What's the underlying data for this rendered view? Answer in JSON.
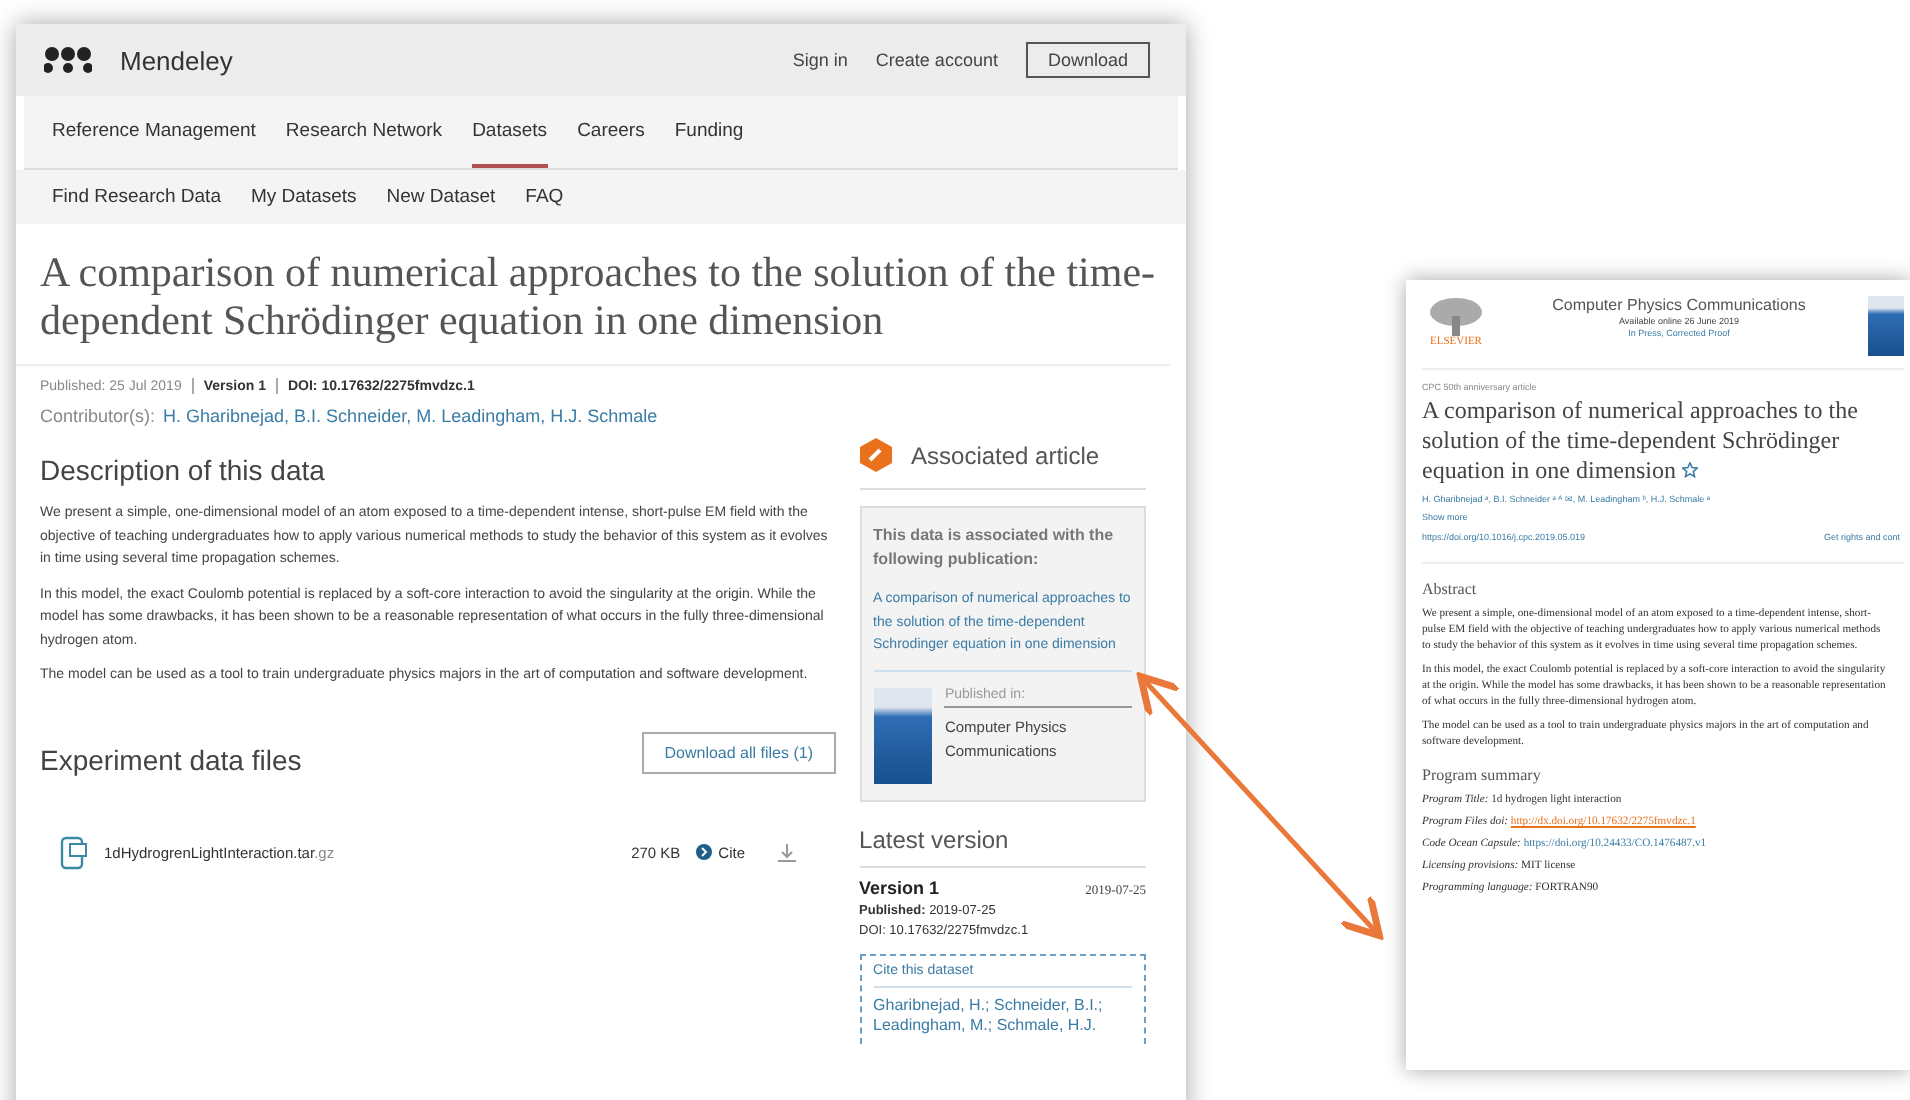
{
  "dataset_page": {
    "header": {
      "brand": "Mendeley",
      "links": [
        "Sign in",
        "Create account"
      ],
      "download_button": "Download"
    },
    "nav": [
      {
        "label": "Reference Management",
        "selected": false
      },
      {
        "label": "Research Network",
        "selected": false
      },
      {
        "label": "Datasets",
        "selected": true
      },
      {
        "label": "Careers",
        "selected": false
      },
      {
        "label": "Funding",
        "selected": false
      }
    ],
    "subnav": [
      "Find Research Data",
      "My Datasets",
      "New Dataset",
      "FAQ"
    ],
    "title": "A comparison of numerical approaches to the solution of the time-dependent Schrödinger equation in one dimension",
    "meta": {
      "published": "Published: 25 Jul 2019",
      "version": "Version 1",
      "doi": "DOI: 10.17632/2275fmvdzc.1"
    },
    "contributors_label": "Contributor(s):",
    "contributors": "H. Gharibnejad, B.I. Schneider, M. Leadingham, H.J. Schmale",
    "description_heading": "Description of this data",
    "description": [
      "We present a simple, one-dimensional model of an atom exposed to a time-dependent intense, short-pulse EM field with the objective of teaching undergraduates how to apply various numerical methods to study the behavior of this system as it evolves in time using several time propagation schemes.",
      "In this model, the exact Coulomb potential is replaced by a soft-core interaction to avoid the singularity at the origin. While the model has some drawbacks, it has been shown to be a reasonable representation of what occurs in the fully three-dimensional hydrogen atom.",
      "The model can be used as a tool to train undergraduate physics majors in the art of computation and software development."
    ],
    "files_heading": "Experiment data files",
    "download_all": "Download all files (1)",
    "files": [
      {
        "name": "1dHydrogrenLightInteraction.tar",
        "ext": ".gz",
        "size": "270 KB",
        "cite": "Cite"
      }
    ],
    "associated": {
      "heading": "Associated article",
      "intro": "This data is associated with the following publication:",
      "link": "A comparison of numerical approaches to the solution of the time-dependent Schrodinger equation in one dimension",
      "published_in_label": "Published in:",
      "journal": "Computer Physics Communications"
    },
    "latest": {
      "heading": "Latest version",
      "version": "Version 1",
      "date": "2019-07-25",
      "published_label": "Published:",
      "published": "2019-07-25",
      "doi": "DOI: 10.17632/2275fmvdzc.1",
      "cite_label": "Cite this dataset",
      "citation": "Gharibnejad, H.; Schneider, B.I.; Leadingham, M.; Schmale, H.J."
    }
  },
  "article_page": {
    "journal": "Computer Physics Communications",
    "publisher": "ELSEVIER",
    "available": "Available online 26 June 2019",
    "status": "In Press, Corrected Proof",
    "article_type": "CPC 50th anniversary article",
    "title": "A comparison of numerical approaches to the solution of the time-dependent Schrödinger equation in one dimension",
    "authors": "H. Gharibnejad ᵃ, B.I. Schneider ᵃ ᴬ ✉, M. Leadingham ᵇ, H.J. Schmale ᵃ",
    "show_more": "Show more",
    "doi_link": "https://doi.org/10.1016/j.cpc.2019.05.019",
    "rights": "Get rights and cont",
    "abstract_heading": "Abstract",
    "abstract": [
      "We present a simple, one-dimensional model of an atom exposed to a time-dependent intense, short-pulse EM field with the objective of teaching undergraduates how to apply various numerical methods to study the behavior of this system as it evolves in time using several time propagation schemes.",
      "In this model, the exact Coulomb potential is replaced by a soft-core interaction to avoid the singularity at the origin. While the model has some drawbacks, it has been shown to be a reasonable representation of what occurs in the fully three-dimensional hydrogen atom.",
      "The model can be used as a tool to train undergraduate physics majors in the art of computation and software development."
    ],
    "summary_heading": "Program summary",
    "summary": [
      {
        "label": "Program Title:",
        "value": "1d hydrogen light interaction",
        "kind": "text"
      },
      {
        "label": "Program Files doi:",
        "value": "http://dx.doi.org/10.17632/2275fmvdzc.1",
        "kind": "highlight"
      },
      {
        "label": "Code Ocean Capsule:",
        "value": "https://doi.org/10.24433/CO.1476487.v1",
        "kind": "link"
      },
      {
        "label": "Licensing provisions:",
        "value": "MIT license",
        "kind": "text"
      },
      {
        "label": "Programming language:",
        "value": "FORTRAN90",
        "kind": "text"
      }
    ]
  }
}
